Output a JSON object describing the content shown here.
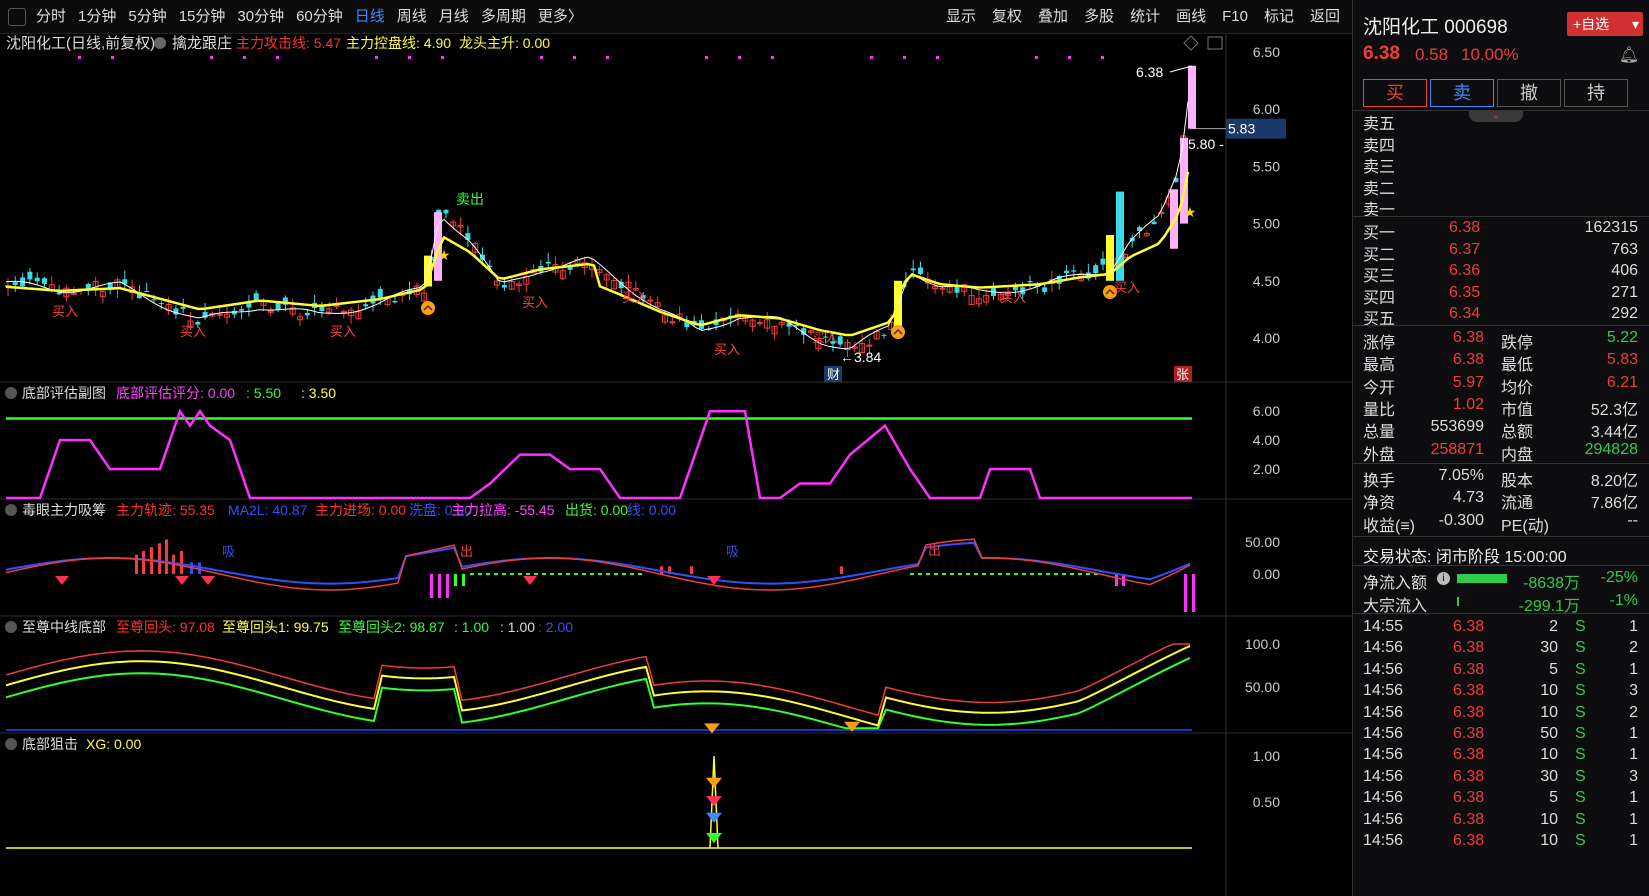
{
  "toolbar": {
    "periods": [
      "分时",
      "1分钟",
      "5分钟",
      "15分钟",
      "30分钟",
      "60分钟",
      "日线",
      "周线",
      "月线",
      "多周期",
      "更多〉"
    ],
    "active_period": "日线",
    "tools": [
      "显示",
      "复权",
      "叠加",
      "多股",
      "统计",
      "画线",
      "F10",
      "标记",
      "返回"
    ]
  },
  "main_panel": {
    "title": "沈阳化工(日线,前复权)",
    "indicator": "擒龙跟庄",
    "legend": [
      {
        "text": "主力攻击线: 5.47",
        "color": "#ff3030"
      },
      {
        "text": "主力控盘线: 4.90",
        "color": "#ffff40"
      },
      {
        "text": "龙头主升: 0.00",
        "color": "#ffff40"
      }
    ],
    "y_ticks": [
      "6.50",
      "6.00",
      "5.50",
      "5.00",
      "4.50",
      "4.00"
    ],
    "price_tag": "5.83",
    "high_label": "6.38",
    "low_label": "←3.84",
    "mark_5_80": "5.80 -",
    "sell_label": "卖出",
    "buy_label": "买入",
    "cai_label": "财",
    "zhang_label": "张"
  },
  "panel2": {
    "title": "底部评估副图",
    "legend": [
      {
        "text": "底部评估评分: 0.00",
        "color": "#ff40ff"
      },
      {
        "text": ": 5.50",
        "color": "#30ff30"
      },
      {
        "text": ": 3.50",
        "color": "#ffff40"
      }
    ],
    "y_ticks": [
      "6.00",
      "4.00",
      "2.00"
    ]
  },
  "panel3": {
    "title": "毒眼主力吸筹",
    "legend": [
      {
        "text": "主力轨迹: 55.35",
        "color": "#ff3030"
      },
      {
        "text": "MA2L: 40.87",
        "color": "#3050ff"
      },
      {
        "text": "主力进场: 0.00",
        "color": "#ff3030"
      },
      {
        "text": "洗盘: 0.00",
        "color": "#3050ff"
      },
      {
        "text": "主力拉高: -55.45",
        "color": "#ff40ff"
      },
      {
        "text": "出货: 0.00",
        "color": "#30ff30"
      },
      {
        "text": "线: 0.00",
        "color": "#3050ff"
      }
    ],
    "y_ticks": [
      "50.00",
      "0.00"
    ],
    "tag_chu": "出",
    "tag_xi": "吸"
  },
  "panel4": {
    "title": "至尊中线底部",
    "legend": [
      {
        "text": "至尊回头: 97.08",
        "color": "#ff3030"
      },
      {
        "text": "至尊回头1: 99.75",
        "color": "#ffff40"
      },
      {
        "text": "至尊回头2: 98.87",
        "color": "#30ff30"
      },
      {
        "text": ": 1.00",
        "color": "#30ff30"
      },
      {
        "text": ": 1.00",
        "color": "#dddddd"
      },
      {
        "text": ": 2.00",
        "color": "#3050ff"
      }
    ],
    "y_ticks": [
      "100.0",
      "50.00"
    ]
  },
  "panel5": {
    "title": "底部狙击",
    "legend": [
      {
        "text": "XG: 0.00",
        "color": "#ffff40"
      }
    ],
    "y_ticks": [
      "1.00",
      "0.50"
    ]
  },
  "stock": {
    "name": "沈阳化工 000698",
    "price": "6.38",
    "change": "0.58",
    "pct": "10.00%",
    "add_fav": "+自选",
    "buy_btn": "买",
    "sell_btn": "卖",
    "cancel_btn": "撤",
    "hold_btn": "持"
  },
  "sell_book": [
    {
      "label": "卖五"
    },
    {
      "label": "卖四"
    },
    {
      "label": "卖三"
    },
    {
      "label": "卖二"
    },
    {
      "label": "卖一"
    }
  ],
  "buy_book": [
    {
      "label": "买一",
      "price": "6.38",
      "vol": "162315"
    },
    {
      "label": "买二",
      "price": "6.37",
      "vol": "763"
    },
    {
      "label": "买三",
      "price": "6.36",
      "vol": "406"
    },
    {
      "label": "买四",
      "price": "6.35",
      "vol": "271"
    },
    {
      "label": "买五",
      "price": "6.34",
      "vol": "292"
    }
  ],
  "stats": [
    {
      "l1": "涨停",
      "v1": "6.38",
      "c1": "red",
      "l2": "跌停",
      "v2": "5.22",
      "c2": "grn"
    },
    {
      "l1": "最高",
      "v1": "6.38",
      "c1": "red",
      "l2": "最低",
      "v2": "5.83",
      "c2": "red"
    },
    {
      "l1": "今开",
      "v1": "5.97",
      "c1": "red",
      "l2": "均价",
      "v2": "6.21",
      "c2": "red"
    },
    {
      "l1": "量比",
      "v1": "1.02",
      "c1": "red",
      "l2": "市值",
      "v2": "52.3亿",
      "c2": "wht"
    },
    {
      "l1": "总量",
      "v1": "553699",
      "c1": "wht",
      "l2": "总额",
      "v2": "3.44亿",
      "c2": "wht"
    },
    {
      "l1": "外盘",
      "v1": "258871",
      "c1": "red",
      "l2": "内盘",
      "v2": "294828",
      "c2": "grn"
    }
  ],
  "stats2": [
    {
      "l1": "换手",
      "v1": "7.05%",
      "l2": "股本",
      "v2": "8.20亿"
    },
    {
      "l1": "净资",
      "v1": "4.73",
      "l2": "流通",
      "v2": "7.86亿"
    },
    {
      "l1": "收益(≡)",
      "v1": "-0.300",
      "l2": "PE(动)",
      "v2": "--"
    }
  ],
  "trade_status": "交易状态: 闭市阶段 15:00:00",
  "flow": [
    {
      "label": "净流入额",
      "value": "-8638万",
      "pct": "-25%"
    },
    {
      "label": "大宗流入",
      "value": "-299.1万",
      "pct": "-1%"
    }
  ],
  "ticks": [
    {
      "t": "14:55",
      "p": "6.38",
      "v": "2",
      "s": "S",
      "n": "1"
    },
    {
      "t": "14:56",
      "p": "6.38",
      "v": "30",
      "s": "S",
      "n": "2"
    },
    {
      "t": "14:56",
      "p": "6.38",
      "v": "5",
      "s": "S",
      "n": "1"
    },
    {
      "t": "14:56",
      "p": "6.38",
      "v": "10",
      "s": "S",
      "n": "3"
    },
    {
      "t": "14:56",
      "p": "6.38",
      "v": "10",
      "s": "S",
      "n": "2"
    },
    {
      "t": "14:56",
      "p": "6.38",
      "v": "50",
      "s": "S",
      "n": "1"
    },
    {
      "t": "14:56",
      "p": "6.38",
      "v": "10",
      "s": "S",
      "n": "1"
    },
    {
      "t": "14:56",
      "p": "6.38",
      "v": "30",
      "s": "S",
      "n": "3"
    },
    {
      "t": "14:56",
      "p": "6.38",
      "v": "5",
      "s": "S",
      "n": "1"
    },
    {
      "t": "14:56",
      "p": "6.38",
      "v": "10",
      "s": "S",
      "n": "1"
    },
    {
      "t": "14:56",
      "p": "6.38",
      "v": "10",
      "s": "S",
      "n": "1"
    }
  ],
  "colors": {
    "up": "#f03c3c",
    "down": "#2fcb4a",
    "accent": "#3d8bff",
    "ma_yellow": "#ffff30",
    "ma_white": "#ffffff",
    "magenta": "#ff30ff"
  }
}
